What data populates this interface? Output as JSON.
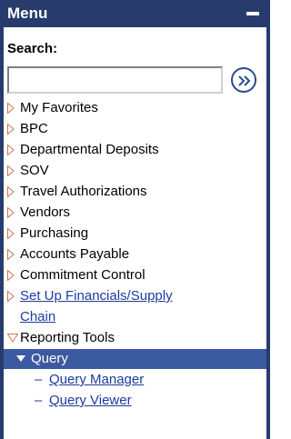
{
  "header": {
    "title": "Menu"
  },
  "search": {
    "label": "Search:",
    "value": "",
    "go_icon": "double-chevron-right-icon"
  },
  "menu": {
    "items": [
      {
        "label": "My Favorites",
        "link": false
      },
      {
        "label": "BPC",
        "link": false
      },
      {
        "label": "Departmental Deposits",
        "link": false
      },
      {
        "label": "SOV",
        "link": false
      },
      {
        "label": "Travel Authorizations",
        "link": false
      },
      {
        "label": "Vendors",
        "link": false
      },
      {
        "label": "Purchasing",
        "link": false
      },
      {
        "label": "Accounts Payable",
        "link": false
      },
      {
        "label": "Commitment Control",
        "link": false
      },
      {
        "label": "Set Up Financials/Supply",
        "label_line2": "Chain",
        "link": true
      },
      {
        "label": "Reporting Tools",
        "link": false,
        "expanded": true
      }
    ],
    "selected": {
      "label": "Query"
    },
    "subitems": [
      {
        "label": "Query Manager"
      },
      {
        "label": "Query Viewer"
      }
    ]
  },
  "colors": {
    "frame": "#273c6c",
    "selected_bg": "#3c5aa0",
    "link": "#1e3aa0",
    "triangle": "#c87850"
  }
}
